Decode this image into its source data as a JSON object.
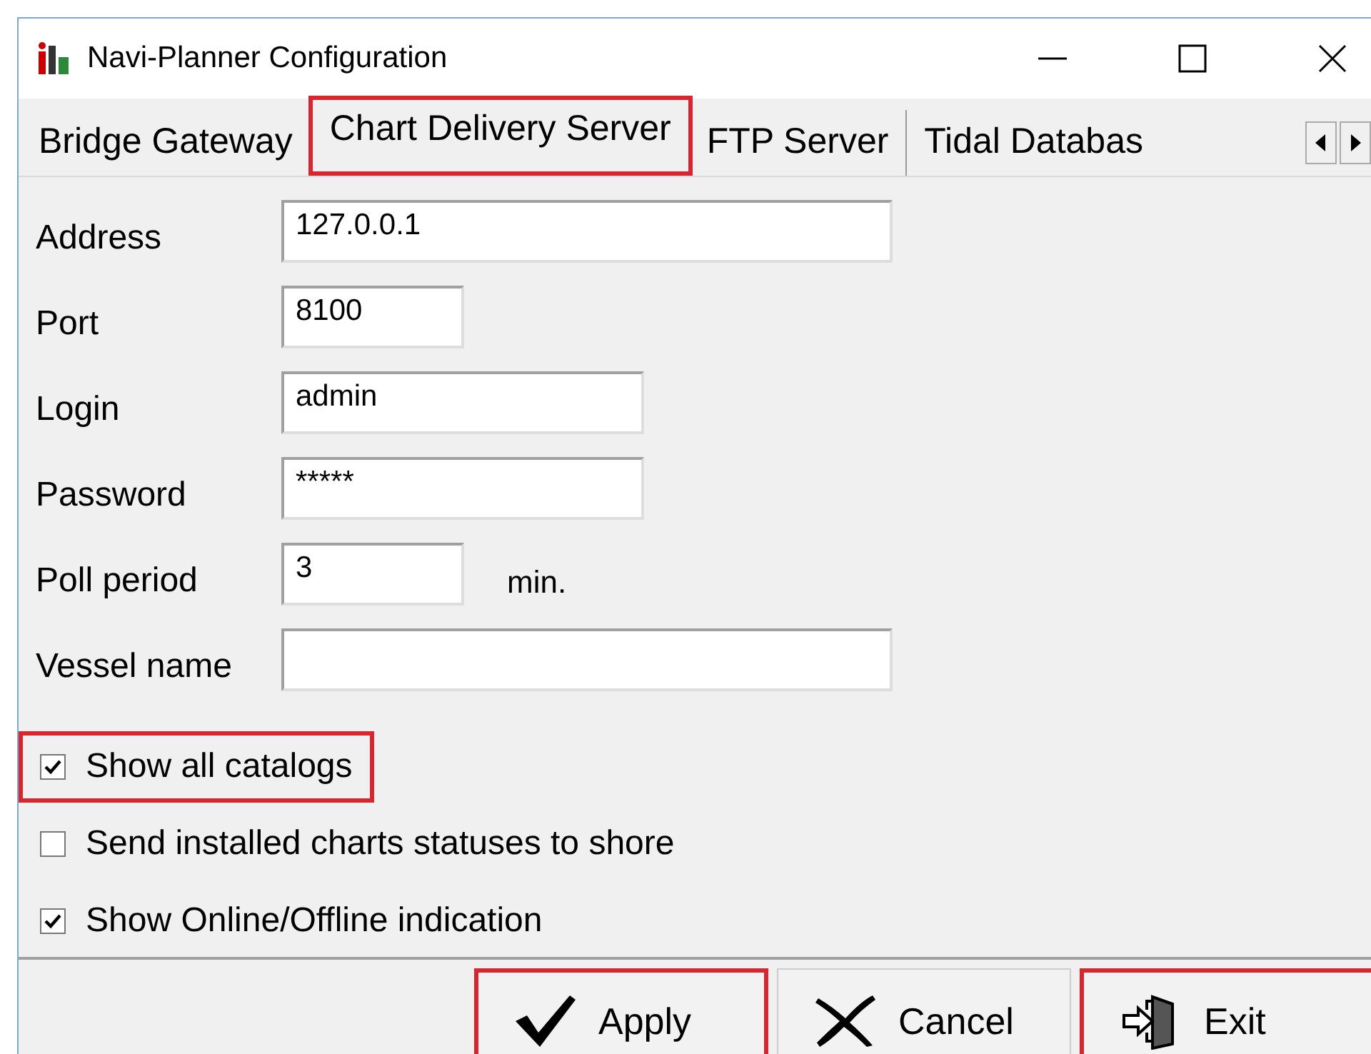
{
  "window": {
    "title": "Navi-Planner Configuration"
  },
  "tabs": [
    {
      "label": "Bridge Gateway",
      "selected": false,
      "highlighted": false
    },
    {
      "label": "Chart Delivery Server",
      "selected": true,
      "highlighted": true
    },
    {
      "label": "FTP Server",
      "selected": false,
      "highlighted": false
    },
    {
      "label": "Tidal Databas",
      "selected": false,
      "highlighted": false
    }
  ],
  "fields": [
    {
      "label": "Address",
      "value": "127.0.0.1"
    },
    {
      "label": "Port",
      "value": "8100"
    },
    {
      "label": "Login",
      "value": "admin"
    },
    {
      "label": "Password",
      "value": "*****"
    },
    {
      "label": "Poll period",
      "value": "3",
      "unit": "min."
    },
    {
      "label": "Vessel name"
    }
  ],
  "checkboxes": [
    {
      "label": "Show all catalogs",
      "checked": true,
      "highlighted": true
    },
    {
      "label": "Send installed charts statuses to shore",
      "checked": false,
      "highlighted": false
    },
    {
      "label": "Show Online/Offline indication",
      "checked": true,
      "highlighted": false
    }
  ],
  "buttons": [
    {
      "label": "Apply",
      "kind": "apply",
      "highlighted": true
    },
    {
      "label": "Cancel",
      "kind": "cancel",
      "highlighted": false
    },
    {
      "label": "Exit",
      "kind": "exit",
      "highlighted": true
    }
  ]
}
